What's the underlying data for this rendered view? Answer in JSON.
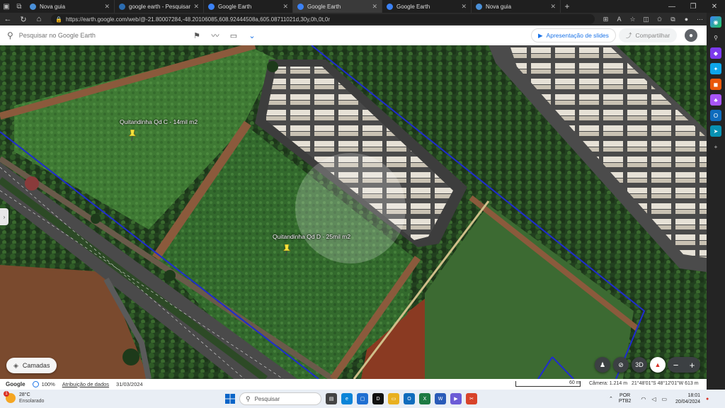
{
  "browser": {
    "tabs": [
      {
        "title": "Nova guia",
        "favicon": "#4a90d9",
        "active": false
      },
      {
        "title": "google earth - Pesquisar",
        "favicon": "#2b6cb0",
        "active": false
      },
      {
        "title": "Google Earth",
        "favicon": "#3b82f6",
        "active": false
      },
      {
        "title": "Google Earth",
        "favicon": "#3b82f6",
        "active": true
      },
      {
        "title": "Google Earth",
        "favicon": "#3b82f6",
        "active": false
      },
      {
        "title": "Nova guia",
        "favicon": "#4a90d9",
        "active": false
      }
    ],
    "url": "https://earth.google.com/web/@-21.80007284,-48.20106085,608.92444508a,605.08711021d,30y,0h,0t,0r"
  },
  "earth": {
    "search_placeholder": "Pesquisar no Google Earth",
    "slides_label": "Apresentação de slides",
    "share_label": "Compartilhar",
    "layers_label": "Camadas",
    "btn_3d": "3D",
    "placemarks": [
      {
        "label": "Quitandinha Qd C - 14mil m2"
      },
      {
        "label": "Quitandinha Qd D - 25mil m2"
      }
    ]
  },
  "status": {
    "google": "Google",
    "zoom": "100%",
    "attribution": "Atribuição de dados",
    "date": "31/03/2024",
    "scale": "60 m",
    "camera": "Câmera: 1.214 m",
    "coords": "21°48'01\"S 48°12'01\"W  613 m"
  },
  "taskbar": {
    "temp": "28°C",
    "condition": "Ensolarado",
    "notif": "1",
    "search": "Pesquisar",
    "lang1": "POR",
    "lang2": "PTB2",
    "time": "18:01",
    "date": "20/04/2024"
  },
  "colors": {
    "accent": "#1a73e8",
    "boundary": "#1f2bd1",
    "pin": "#f5e23b"
  }
}
